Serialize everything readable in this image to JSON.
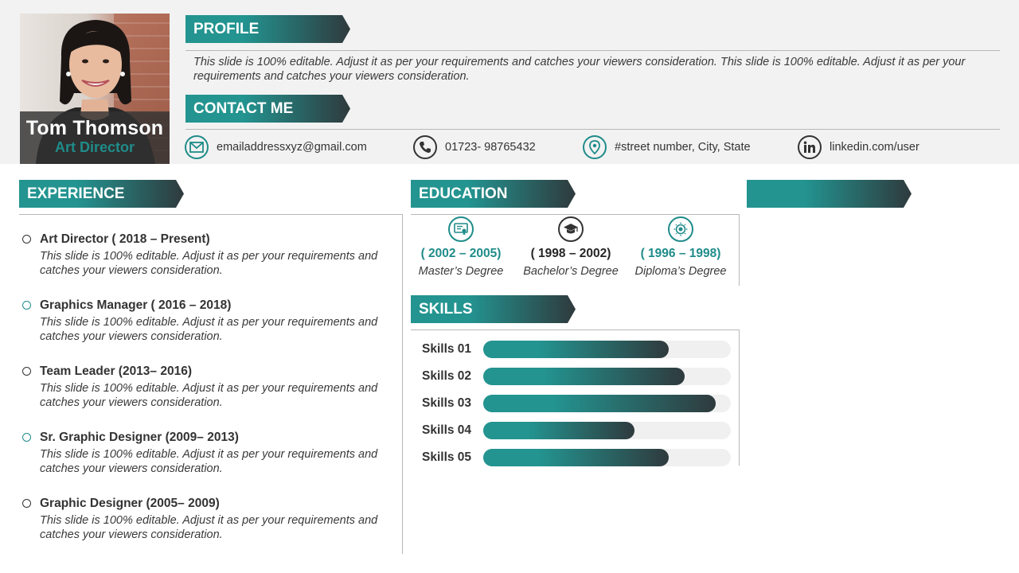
{
  "profile": {
    "name": "Tom Thomson",
    "role": "Art Director",
    "heading": "PROFILE",
    "text": "This slide is 100% editable. Adjust it as per your requirements and catches your viewers consideration. This slide is 100% editable. Adjust it as per your requirements and catches your viewers consideration."
  },
  "contact": {
    "heading": "CONTACT ME",
    "email": "emailaddressxyz@gmail.com",
    "phone": "01723- 98765432",
    "address": "#street number, City, State",
    "linkedin": "linkedin.com/user"
  },
  "experience": {
    "heading": "EXPERIENCE",
    "items": [
      {
        "title": "Art Director ( 2018 – Present)",
        "desc": "This slide is 100% editable. Adjust it as per your requirements and catches your viewers consideration."
      },
      {
        "title": "Graphics Manager ( 2016 – 2018)",
        "desc": "This slide is 100% editable. Adjust it as per your requirements and catches your viewers consideration."
      },
      {
        "title": " Team Leader (2013– 2016)",
        "desc": "This slide is 100% editable. Adjust it as per your requirements and catches your viewers consideration."
      },
      {
        "title": " Sr. Graphic Designer (2009– 2013)",
        "desc": "This slide is 100% editable. Adjust it as per your requirements and catches your viewers consideration."
      },
      {
        "title": " Graphic Designer (2005– 2009)",
        "desc": "This slide is 100% editable. Adjust it as per your requirements and catches your viewers consideration."
      }
    ]
  },
  "education": {
    "heading": "EDUCATION",
    "items": [
      {
        "years": "( 2002 – 2005)",
        "degree": "Master’s Degree",
        "icon": "certificate-icon"
      },
      {
        "years": "( 1998 – 2002)",
        "degree": "Bachelor’s Degree",
        "icon": "graduation-cap-icon"
      },
      {
        "years": "( 1996 – 1998)",
        "degree": "Diploma’s Degree",
        "icon": "award-seal-icon"
      }
    ]
  },
  "skills": {
    "heading": "SKILLS",
    "items": [
      {
        "label": "Skills 01",
        "level": 0.75
      },
      {
        "label": "Skills 02",
        "level": 0.815
      },
      {
        "label": "Skills 03",
        "level": 0.94
      },
      {
        "label": "Skills 04",
        "level": 0.61
      },
      {
        "label": "Skills 05",
        "level": 0.75
      }
    ]
  },
  "extra_section": {
    "heading": ""
  },
  "colors": {
    "accent": "#239490",
    "dark": "#2f3a3d",
    "band": "#f2f2f2"
  }
}
